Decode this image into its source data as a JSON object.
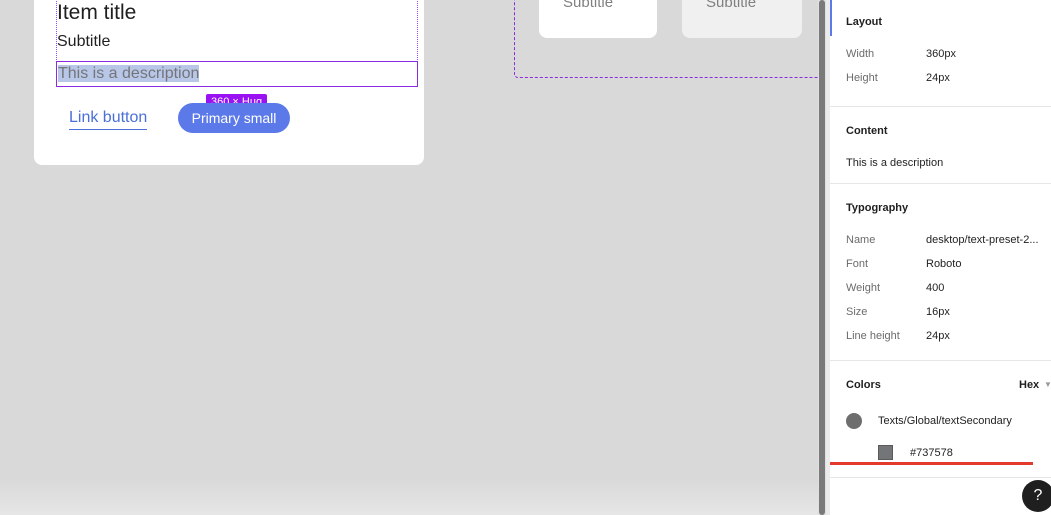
{
  "canvas": {
    "card": {
      "item_title": "Item title",
      "subtitle": "Subtitle",
      "description": "This is a description",
      "size_badge": "360 × Hug",
      "link_button": "Link button",
      "primary_button": "Primary small"
    },
    "mini_cards": [
      {
        "subtitle": "Subtitle"
      },
      {
        "subtitle": "Subtitle"
      }
    ]
  },
  "panel": {
    "layout": {
      "title": "Layout",
      "width_label": "Width",
      "width_value": "360px",
      "height_label": "Height",
      "height_value": "24px"
    },
    "content": {
      "title": "Content",
      "value": "This is a description"
    },
    "typography": {
      "title": "Typography",
      "name_label": "Name",
      "name_value": "desktop/text-preset-2...",
      "font_label": "Font",
      "font_value": "Roboto",
      "weight_label": "Weight",
      "weight_value": "400",
      "size_label": "Size",
      "size_value": "16px",
      "line_height_label": "Line height",
      "line_height_value": "24px"
    },
    "colors": {
      "title": "Colors",
      "format": "Hex",
      "style_name": "Texts/Global/textSecondary",
      "hex": "#737578",
      "swatch_color": "#737578"
    },
    "help_label": "?"
  }
}
